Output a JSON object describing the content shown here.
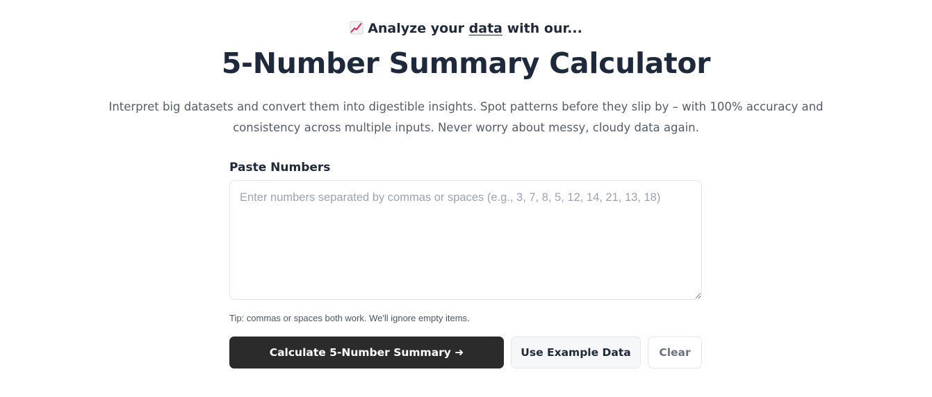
{
  "header": {
    "icon": "chart-increasing-icon",
    "eyebrow_before": "Analyze your ",
    "eyebrow_link": "data",
    "eyebrow_after": " with our...",
    "title": "5-Number Summary Calculator",
    "subtitle": "Interpret big datasets and convert them into digestible insights. Spot patterns before they slip by – with 100% accuracy and consistency across multiple inputs. Never worry about messy, cloudy data again."
  },
  "form": {
    "label": "Paste Numbers",
    "input_value": "",
    "placeholder": "Enter numbers separated by commas or spaces (e.g., 3, 7, 8, 5, 12, 14, 21, 13, 18)",
    "tip": "Tip: commas or spaces both work. We'll ignore empty items."
  },
  "actions": {
    "calculate_label": "Calculate 5-Number Summary ➜",
    "example_label": "Use Example Data",
    "clear_label": "Clear"
  },
  "colors": {
    "primary_button": "#2b2b2b",
    "title_text": "#1e293b",
    "icon_line": "#e0245e"
  }
}
